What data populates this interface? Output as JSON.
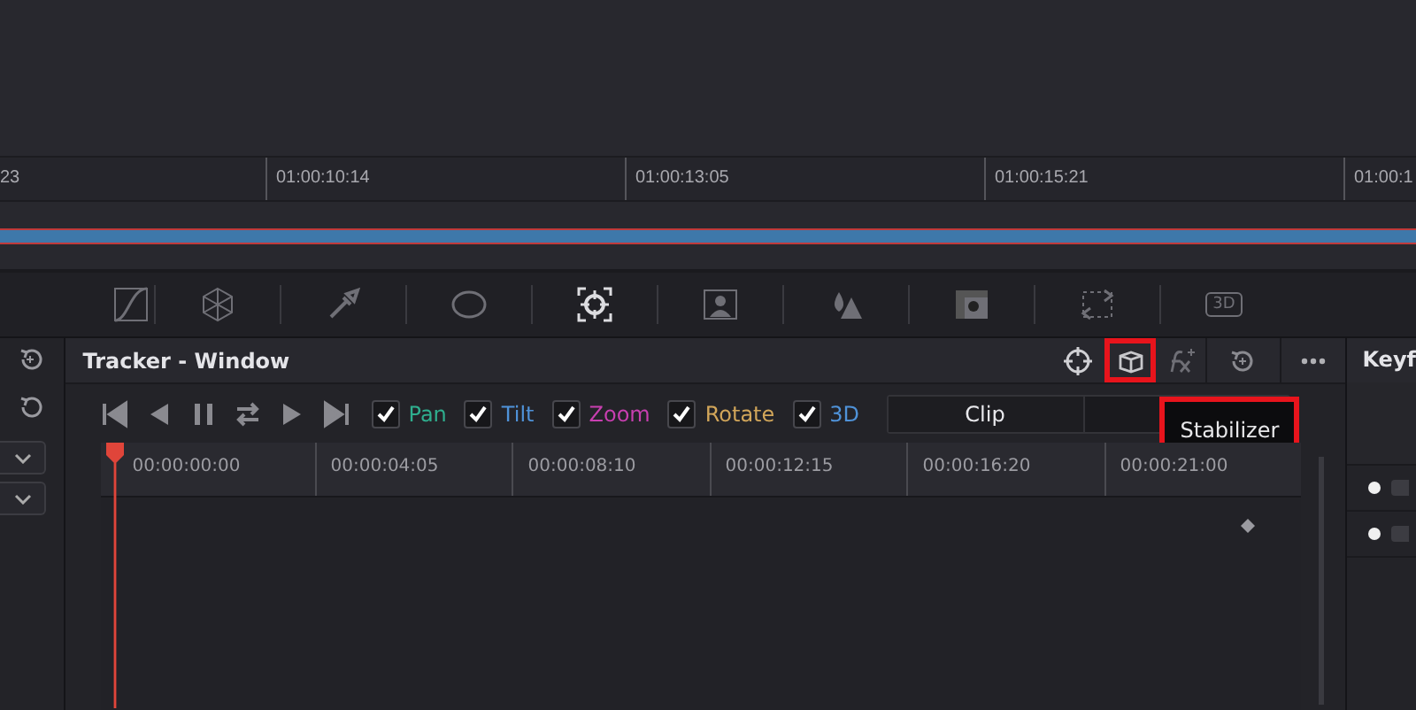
{
  "timeline": {
    "ruler": [
      "23",
      "01:00:10:14",
      "01:00:13:05",
      "01:00:15:21",
      "01:00:1"
    ]
  },
  "palette": [
    {
      "kind": "curves",
      "selected": false
    },
    {
      "kind": "warper",
      "selected": false
    },
    {
      "kind": "picker",
      "selected": false
    },
    {
      "kind": "window",
      "selected": false
    },
    {
      "kind": "tracker",
      "selected": true
    },
    {
      "kind": "matte",
      "selected": false
    },
    {
      "kind": "blur",
      "selected": false
    },
    {
      "kind": "key",
      "selected": false
    },
    {
      "kind": "sizing",
      "selected": false
    },
    {
      "kind": "stereo",
      "selected": false,
      "label": "3D"
    }
  ],
  "tracker": {
    "title": "Tracker - Window",
    "header_tools": [
      {
        "kind": "target",
        "highlighted": false
      },
      {
        "kind": "stabilizer",
        "highlighted": true
      },
      {
        "kind": "fx",
        "highlighted": false
      },
      {
        "kind": "reset",
        "highlighted": false
      },
      {
        "kind": "more",
        "highlighted": false
      }
    ],
    "transport": [
      {
        "kind": "first"
      },
      {
        "kind": "back"
      },
      {
        "kind": "pause"
      },
      {
        "kind": "both"
      },
      {
        "kind": "forward"
      },
      {
        "kind": "last"
      }
    ],
    "options": [
      {
        "label": "Pan",
        "checked": true,
        "color": "#2fae8e"
      },
      {
        "label": "Tilt",
        "checked": true,
        "color": "#4f92d8"
      },
      {
        "label": "Zoom",
        "checked": true,
        "color": "#c83fb0"
      },
      {
        "label": "Rotate",
        "checked": true,
        "color": "#d2a65a"
      },
      {
        "label": "3D",
        "checked": true,
        "color": "#4f92d8"
      }
    ],
    "modes": [
      {
        "label": "Clip",
        "selected": true
      }
    ],
    "tooltip": {
      "text": "Stabilizer",
      "highlighted": true
    },
    "ruler": [
      "00:00:00:00",
      "00:00:04:05",
      "00:00:08:10",
      "00:00:12:15",
      "00:00:16:20",
      "00:00:21:00"
    ]
  },
  "keyframes": {
    "title": "Keyf"
  }
}
